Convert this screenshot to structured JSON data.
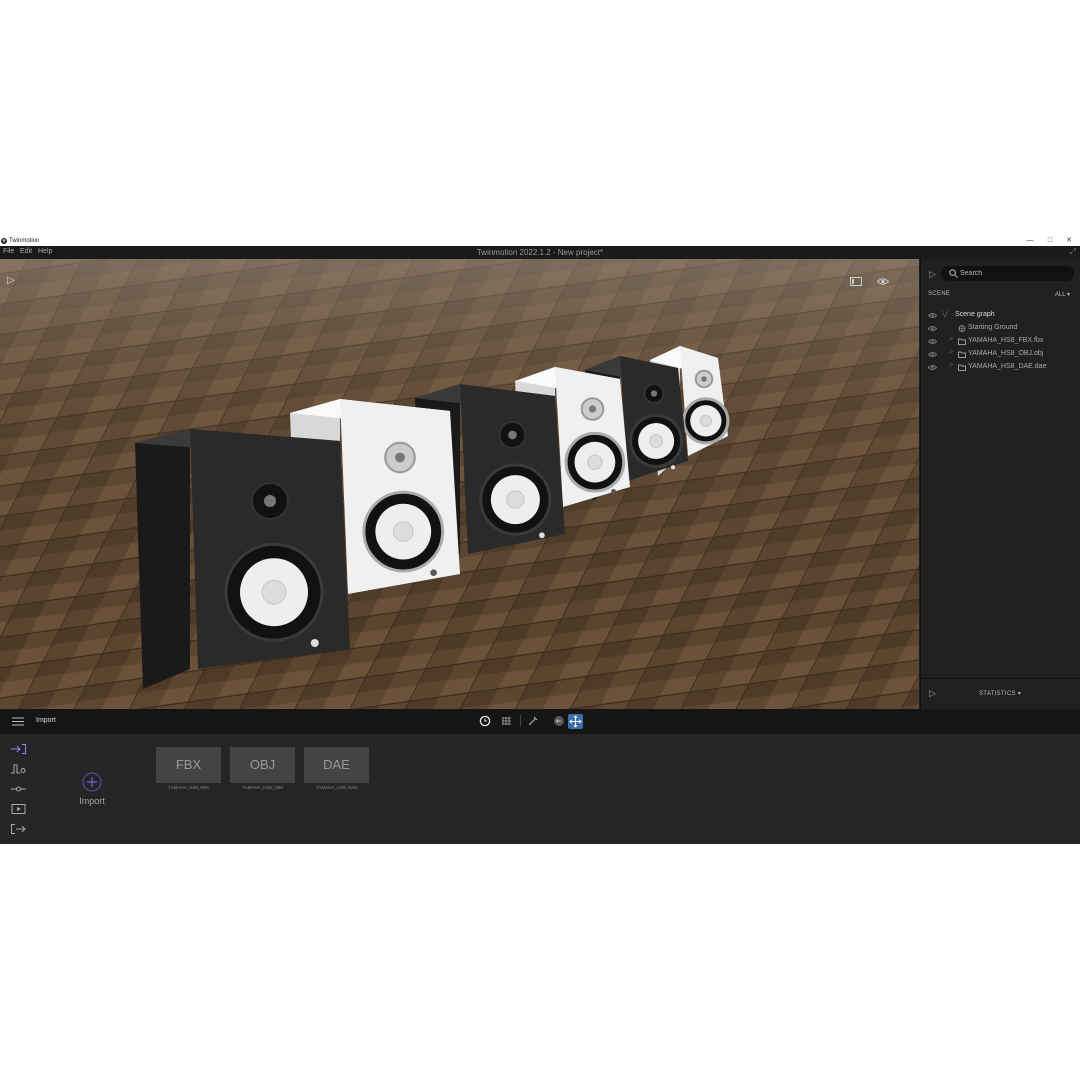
{
  "os": {
    "app_name": "Twinmotion",
    "buttons": {
      "minimize": "—",
      "maximize": "□",
      "close": "✕"
    }
  },
  "menu": {
    "items": [
      "File",
      "Edit",
      "Help"
    ],
    "window_title": "Twinmotion 2022.1.2 - New project*",
    "expand_glyph": "⤢"
  },
  "viewport": {
    "play_glyph": "▷",
    "speakers": [
      {
        "finish": "black",
        "fill": "#2a2a2a"
      },
      {
        "finish": "white",
        "fill": "#f0f0f0"
      },
      {
        "finish": "black",
        "fill": "#2a2a2a"
      },
      {
        "finish": "white",
        "fill": "#f0f0f0"
      },
      {
        "finish": "black",
        "fill": "#2a2a2a"
      },
      {
        "finish": "white",
        "fill": "#f0f0f0"
      }
    ]
  },
  "panel": {
    "search_placeholder": "Search",
    "scene_label": "SCENE",
    "filter": "ALL",
    "tree": [
      {
        "label": "Scene graph",
        "type": "root",
        "expanded": true
      },
      {
        "label": "Starting Ground",
        "type": "ground"
      },
      {
        "label": "YAMAHA_HS8_FBX.fbx",
        "type": "folder"
      },
      {
        "label": "YAMAHA_HS8_OBJ.obj",
        "type": "folder"
      },
      {
        "label": "YAMAHA_HS8_DAE.dae",
        "type": "folder"
      }
    ],
    "statistics_label": "STATISTICS"
  },
  "toolbar": {
    "section_title": "Import"
  },
  "bottom": {
    "import_label": "Import",
    "files": [
      {
        "format": "FBX",
        "name": "YAMAHA_HS8_FBX"
      },
      {
        "format": "OBJ",
        "name": "YAMAHA_HS8_OBJ"
      },
      {
        "format": "DAE",
        "name": "YAMAHA_HS8_DAE"
      }
    ]
  },
  "colors": {
    "accent": "#7b5fd0",
    "active_tool": "#3d6ea8"
  }
}
